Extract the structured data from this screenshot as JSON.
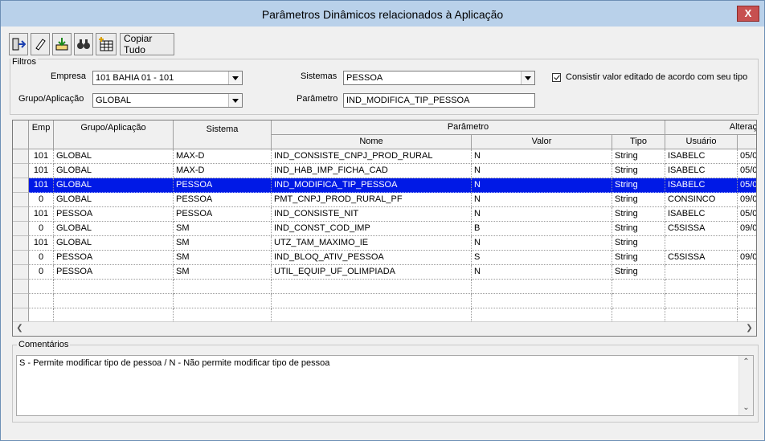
{
  "window": {
    "title": "Parâmetros Dinâmicos relacionados à Aplicação",
    "close_label": "X"
  },
  "toolbar": {
    "buttons": [
      {
        "name": "exit-icon"
      },
      {
        "name": "eraser-icon"
      },
      {
        "name": "import-icon"
      },
      {
        "name": "binoculars-icon"
      },
      {
        "name": "grid-add-icon"
      }
    ],
    "copy_all_label": "Copiar Tudo"
  },
  "filters": {
    "legend": "Filtros",
    "empresa_label": "Empresa",
    "empresa_value": "101 BAHIA 01 - 101",
    "grupo_label": "Grupo/Aplicação",
    "grupo_value": "GLOBAL",
    "sistemas_label": "Sistemas",
    "sistemas_value": "PESSOA",
    "parametro_label": "Parâmetro",
    "parametro_value": "IND_MODIFICA_TIP_PESSOA",
    "consistir_label": "Consistir valor editado de acordo com seu tipo",
    "consistir_checked": true
  },
  "grid": {
    "headers": {
      "emp": "Emp",
      "grupo": "Grupo/Aplicação",
      "sistema": "Sistema",
      "parametro": "Parâmetro",
      "nome": "Nome",
      "valor": "Valor",
      "tipo": "Tipo",
      "alteracao": "Alteraç",
      "usuario": "Usuário"
    },
    "rows": [
      {
        "emp": "101",
        "grupo": "GLOBAL",
        "sistema": "MAX-D",
        "nome": "IND_CONSISTE_CNPJ_PROD_RURAL",
        "valor": "N",
        "tipo": "String",
        "usuario": "ISABELC",
        "data": "05/0",
        "selected": false
      },
      {
        "emp": "101",
        "grupo": "GLOBAL",
        "sistema": "MAX-D",
        "nome": "IND_HAB_IMP_FICHA_CAD",
        "valor": "N",
        "tipo": "String",
        "usuario": "ISABELC",
        "data": "05/0",
        "selected": false
      },
      {
        "emp": "101",
        "grupo": "GLOBAL",
        "sistema": "PESSOA",
        "nome": "IND_MODIFICA_TIP_PESSOA",
        "valor": "N",
        "tipo": "String",
        "usuario": "ISABELC",
        "data": "05/0",
        "selected": true
      },
      {
        "emp": "0",
        "grupo": "GLOBAL",
        "sistema": "PESSOA",
        "nome": "PMT_CNPJ_PROD_RURAL_PF",
        "valor": "N",
        "tipo": "String",
        "usuario": "CONSINCO",
        "data": "09/0",
        "selected": false
      },
      {
        "emp": "101",
        "grupo": "PESSOA",
        "sistema": "PESSOA",
        "nome": "IND_CONSISTE_NIT",
        "valor": "N",
        "tipo": "String",
        "usuario": "ISABELC",
        "data": "05/0",
        "selected": false
      },
      {
        "emp": "0",
        "grupo": "GLOBAL",
        "sistema": "SM",
        "nome": "IND_CONST_COD_IMP",
        "valor": "B",
        "tipo": "String",
        "usuario": "C5SISSA",
        "data": "09/0",
        "selected": false
      },
      {
        "emp": "101",
        "grupo": "GLOBAL",
        "sistema": "SM",
        "nome": "UTZ_TAM_MAXIMO_IE",
        "valor": "N",
        "tipo": "String",
        "usuario": "",
        "data": "",
        "selected": false
      },
      {
        "emp": "0",
        "grupo": "PESSOA",
        "sistema": "SM",
        "nome": "IND_BLOQ_ATIV_PESSOA",
        "valor": "S",
        "tipo": "String",
        "usuario": "C5SISSA",
        "data": "09/0",
        "selected": false
      },
      {
        "emp": "0",
        "grupo": "PESSOA",
        "sistema": "SM",
        "nome": "UTIL_EQUIP_UF_OLIMPIADA",
        "valor": "N",
        "tipo": "String",
        "usuario": "",
        "data": "",
        "selected": false
      },
      {
        "emp": "",
        "grupo": "",
        "sistema": "",
        "nome": "",
        "valor": "",
        "tipo": "",
        "usuario": "",
        "data": "",
        "selected": false
      },
      {
        "emp": "",
        "grupo": "",
        "sistema": "",
        "nome": "",
        "valor": "",
        "tipo": "",
        "usuario": "",
        "data": "",
        "selected": false
      },
      {
        "emp": "",
        "grupo": "",
        "sistema": "",
        "nome": "",
        "valor": "",
        "tipo": "",
        "usuario": "",
        "data": "",
        "selected": false
      },
      {
        "emp": "",
        "grupo": "",
        "sistema": "",
        "nome": "",
        "valor": "",
        "tipo": "",
        "usuario": "",
        "data": "",
        "selected": false
      }
    ]
  },
  "comments": {
    "legend": "Comentários",
    "text": "S - Permite modificar tipo de pessoa / N - Não permite modificar tipo de pessoa"
  },
  "colors": {
    "selection": "#0019e6",
    "titlebar": "#b9d1ea"
  }
}
